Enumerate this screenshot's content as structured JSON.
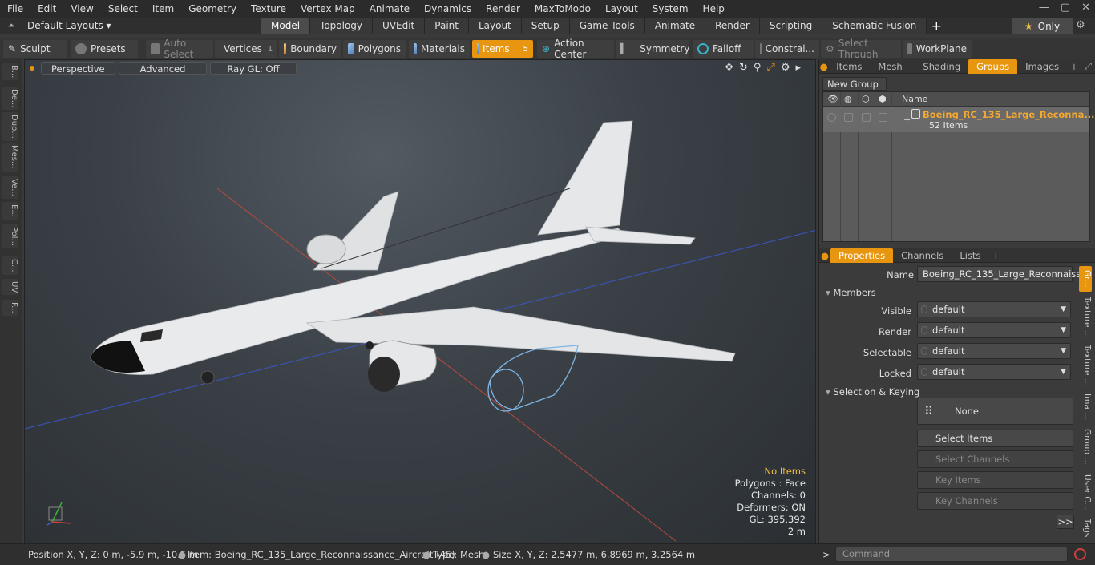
{
  "menu": [
    "File",
    "Edit",
    "View",
    "Select",
    "Item",
    "Geometry",
    "Texture",
    "Vertex Map",
    "Animate",
    "Dynamics",
    "Render",
    "MaxToModo",
    "Layout",
    "System",
    "Help"
  ],
  "layout_selector": "Default Layouts ▾",
  "tabs": [
    "Model",
    "Topology",
    "UVEdit",
    "Paint",
    "Layout",
    "Setup",
    "Game Tools",
    "Animate",
    "Render",
    "Scripting",
    "Schematic Fusion"
  ],
  "active_tab": "Model",
  "only_label": "Only",
  "toolbar": {
    "sculpt": "Sculpt",
    "presets": "Presets",
    "auto_select": "Auto Select",
    "vertices": "Vertices",
    "vertices_count": "1",
    "boundary": "Boundary",
    "polygons": "Polygons",
    "materials": "Materials",
    "items": "Items",
    "items_count": "5",
    "action_center": "Action Center",
    "symmetry": "Symmetry",
    "falloff": "Falloff",
    "constraints": "Constrai...",
    "select_through": "Select Through",
    "workplane": "WorkPlane"
  },
  "left_strip": [
    "B...",
    "De...",
    "Dup...",
    "Mes...",
    "Ve...",
    "E...",
    "Pol...",
    "C...",
    "UV",
    "F..."
  ],
  "viewport": {
    "view_mode": "Perspective",
    "shading": "Advanced",
    "raygl": "Ray GL: Off",
    "hud": {
      "selection": "No Items",
      "polygons": "Polygons : Face",
      "channels": "Channels: 0",
      "deformers": "Deformers: ON",
      "gl": "GL: 395,392",
      "scale": "2 m"
    }
  },
  "groups_panel": {
    "tabs": [
      "Items",
      "Mesh ...",
      "Shading",
      "Groups",
      "Images"
    ],
    "active_tab": "Groups",
    "new_group": "New Group",
    "col_name": "Name",
    "group_name": "Boeing_RC_135_Large_Reconna...",
    "group_count": "52 Items"
  },
  "properties_panel": {
    "tabs": [
      "Properties",
      "Channels",
      "Lists"
    ],
    "active_tab": "Properties",
    "name_label": "Name",
    "name_value": "Boeing_RC_135_Large_Reconnaissan",
    "members_section": "Members",
    "visible_label": "Visible",
    "visible_value": "default",
    "render_label": "Render",
    "render_value": "default",
    "selectable_label": "Selectable",
    "selectable_value": "default",
    "locked_label": "Locked",
    "locked_value": "default",
    "selkey_section": "Selection & Keying",
    "none_label": "None",
    "select_items": "Select Items",
    "select_channels": "Select Channels",
    "key_items": "Key Items",
    "key_channels": "Key Channels",
    "more": ">>",
    "side_tabs": [
      "Gr...",
      "Texture ...",
      "Texture ...",
      "Ima ...",
      "Group ...",
      "User C...",
      "Tags"
    ]
  },
  "status": {
    "position": "Position X, Y, Z:   0 m, -5.9 m, -10.5 m",
    "item": "Item:  Boeing_RC_135_Large_Reconnaissance_Aircraft (45)",
    "type": "Type:  Mesh",
    "size": "Size X, Y, Z:   2.5477 m, 6.8969 m, 3.2564 m",
    "command_placeholder": "Command"
  },
  "colors": {
    "accent": "#e8950f",
    "group_name": "#f4a830",
    "hud_warn": "#f0c040"
  }
}
